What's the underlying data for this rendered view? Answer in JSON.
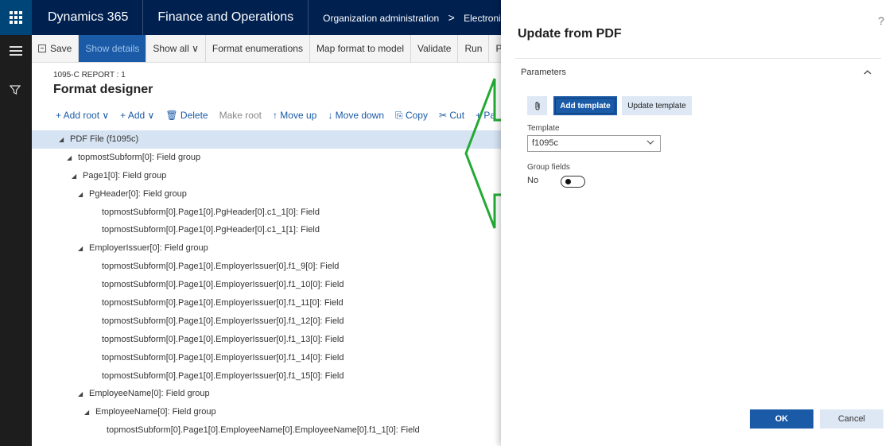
{
  "topbar": {
    "brand": "Dynamics 365",
    "module": "Finance and Operations",
    "breadcrumb_1": "Organization administration",
    "breadcrumb_sep": ">",
    "breadcrumb_2": "Electronic reporting"
  },
  "actionbar": {
    "save": "Save",
    "show_details": "Show details",
    "show_all": "Show all ∨",
    "format_enumerations": "Format enumerations",
    "map_format": "Map format to model",
    "validate": "Validate",
    "run": "Run",
    "performance": "Performa"
  },
  "designer": {
    "report_label": "1095-C REPORT : 1",
    "title": "Format designer",
    "commands": {
      "add_root": "+ Add root ∨",
      "add": "+ Add ∨",
      "delete": "🗑 Delete",
      "make_root": "Make root",
      "move_up": "↑ Move up",
      "move_down": "↓ Move down",
      "copy": "⎘ Copy",
      "cut": "✂ Cut",
      "paste": "+ Pa"
    },
    "tree": [
      "PDF File (f1095c)",
      "topmostSubform[0]: Field group",
      "Page1[0]: Field group",
      "PgHeader[0]: Field group",
      "topmostSubform[0].Page1[0].PgHeader[0].c1_1[0]: Field",
      "topmostSubform[0].Page1[0].PgHeader[0].c1_1[1]: Field",
      "EmployerIssuer[0]: Field group",
      "topmostSubform[0].Page1[0].EmployerIssuer[0].f1_9[0]: Field",
      "topmostSubform[0].Page1[0].EmployerIssuer[0].f1_10[0]: Field",
      "topmostSubform[0].Page1[0].EmployerIssuer[0].f1_11[0]: Field",
      "topmostSubform[0].Page1[0].EmployerIssuer[0].f1_12[0]: Field",
      "topmostSubform[0].Page1[0].EmployerIssuer[0].f1_13[0]: Field",
      "topmostSubform[0].Page1[0].EmployerIssuer[0].f1_14[0]: Field",
      "topmostSubform[0].Page1[0].EmployerIssuer[0].f1_15[0]: Field",
      "EmployeeName[0]: Field group",
      "EmployeeName[0]: Field group",
      "topmostSubform[0].Page1[0].EmployeeName[0].EmployeeName[0].f1_1[0]: Field"
    ]
  },
  "dialog": {
    "help": "?",
    "title": "Update from PDF",
    "section": "Parameters",
    "add_template": "Add template",
    "update_template": "Update template",
    "template_label": "Template",
    "template_value": "f1095c",
    "group_fields_label": "Group fields",
    "group_fields_value": "No",
    "ok": "OK",
    "cancel": "Cancel"
  },
  "colors": {
    "nav": "#002050",
    "accent": "#1a5aa6",
    "arrow": "#22aa33"
  }
}
